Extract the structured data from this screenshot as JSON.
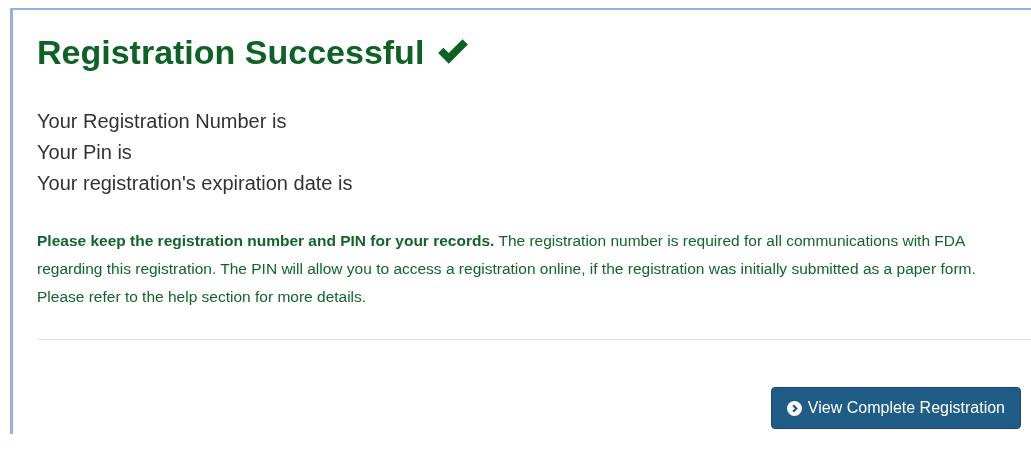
{
  "title": "Registration Successful",
  "info_lines": [
    "Your Registration Number is",
    "Your Pin is",
    "Your registration's expiration date is"
  ],
  "notice": "**Please keep the registration number and PIN for your records.** The registration number is required for all communications with FDA regarding this registration. The PIN will allow you to access a registration online, if the registration was initially submitted as a paper form. Please refer to the help section for more details.",
  "button": {
    "label": "View Complete Registration"
  }
}
